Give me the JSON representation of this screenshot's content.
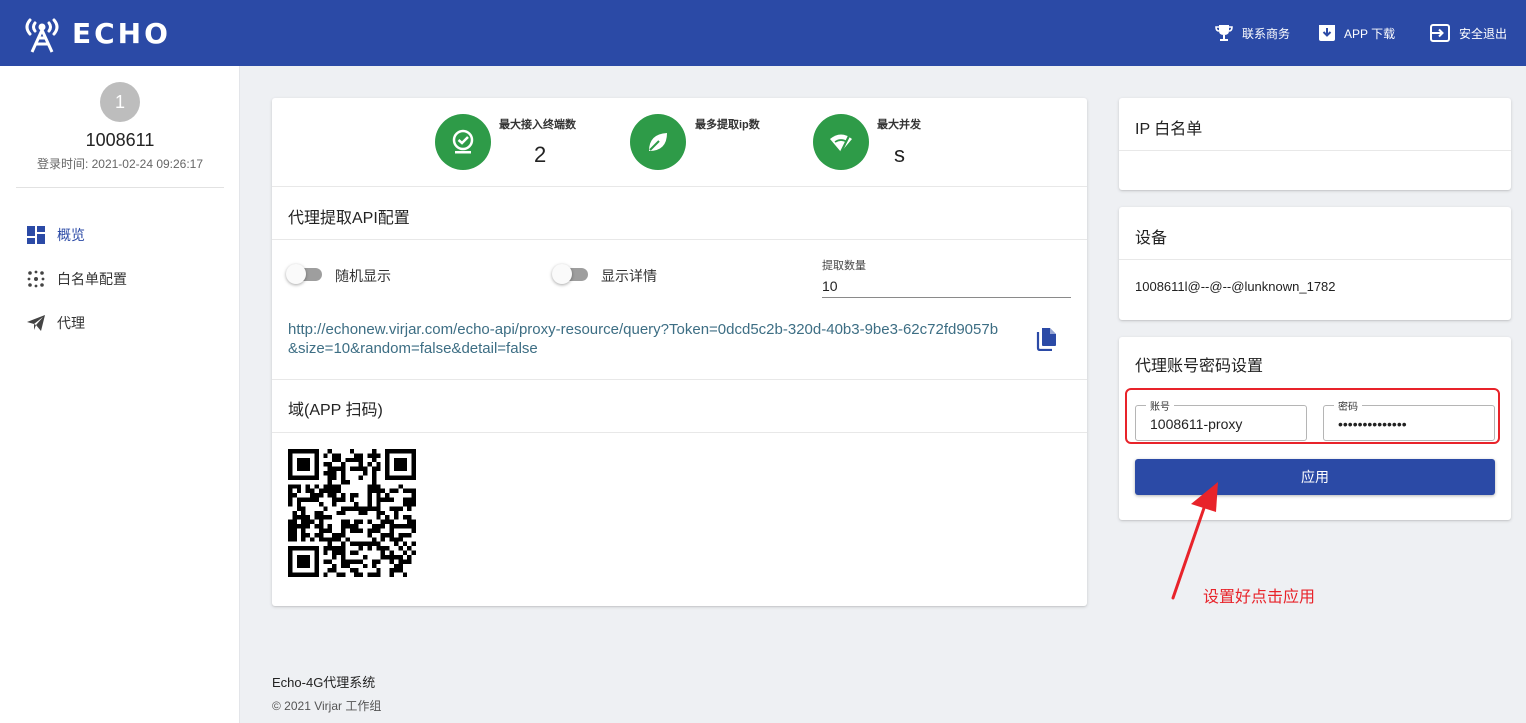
{
  "header": {
    "logo_text": "ECHO",
    "business": "联系商务",
    "app_download": "APP 下载",
    "logout": "安全退出"
  },
  "sidebar": {
    "avatar_initial": "1",
    "username": "1008611",
    "login_time": "登录时间: 2021-02-24 09:26:17",
    "items": [
      {
        "label": "概览",
        "icon": "dashboard-icon",
        "active": true
      },
      {
        "label": "白名单配置",
        "icon": "dots-grid-icon",
        "active": false
      },
      {
        "label": "代理",
        "icon": "send-icon",
        "active": false
      }
    ]
  },
  "stats": [
    {
      "label": "最大接入终端数",
      "value": "2",
      "icon": "check-icon"
    },
    {
      "label": "最多提取ip数",
      "value": "",
      "icon": "leaf-icon"
    },
    {
      "label": "最大并发",
      "value": "s",
      "icon": "wifi-icon"
    }
  ],
  "api_config": {
    "title": "代理提取API配置",
    "random_label": "随机显示",
    "random_on": false,
    "detail_label": "显示详情",
    "detail_on": false,
    "quantity_label": "提取数量",
    "quantity_value": "10",
    "url": "http://echonew.virjar.com/echo-api/proxy-resource/query?Token=0dcd5c2b-320d-40b3-9be3-62c72fd9057b&size=10&random=false&detail=false",
    "copy_icon": "copy-icon"
  },
  "qr_section": {
    "title": "域(APP 扫码)"
  },
  "whitelist": {
    "title": "IP 白名单"
  },
  "devices": {
    "title": "设备",
    "entries": [
      "1008611l@--@--@lunknown_1782"
    ]
  },
  "proxy_account": {
    "title": "代理账号密码设置",
    "account_label": "账号",
    "account_value": "1008611-proxy",
    "password_label": "密码",
    "password_value": "••••••••••••••",
    "apply_label": "应用"
  },
  "annotation": {
    "text": "设置好点击应用",
    "color": "#e8232a"
  },
  "footer": {
    "title": "Echo-4G代理系统",
    "copyright": "© 2021 Virjar 工作组"
  },
  "colors": {
    "primary": "#2b4aa6",
    "stat_green": "#2e9b48",
    "link": "#3d6e84"
  }
}
